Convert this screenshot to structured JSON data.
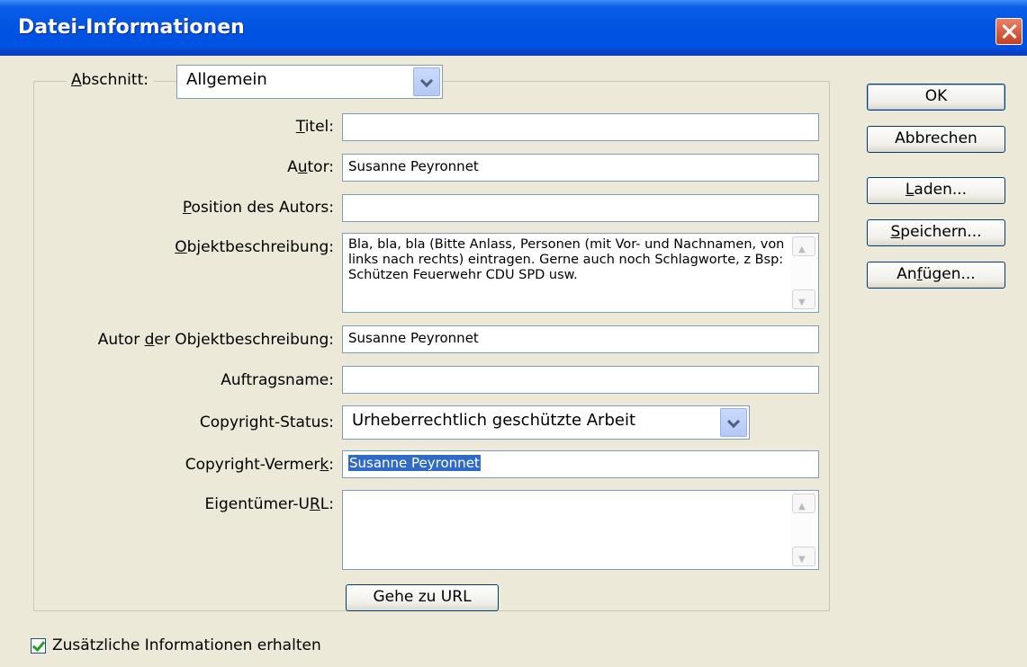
{
  "window": {
    "title": "Datei-Informationen"
  },
  "section": {
    "label_accel": "A",
    "label_rest": "bschnitt:",
    "value": "Allgemein"
  },
  "fields": {
    "titel": {
      "label_accel": "T",
      "label_rest": "itel:",
      "value": ""
    },
    "autor": {
      "label_pre": "A",
      "label_accel": "u",
      "label_rest": "tor:",
      "value": "Susanne Peyronnet"
    },
    "position": {
      "label_accel": "P",
      "label_rest": "osition des Autors:",
      "value": ""
    },
    "beschreibung": {
      "label_pre": "",
      "label_accel": "O",
      "label_rest": "bjektbeschreibung:",
      "value": "Bla, bla, bla (Bitte Anlass, Personen (mit Vor- und Nachnamen, von links nach rechts) eintragen. Gerne auch noch Schlagworte, z Bsp: Schützen Feuerwehr CDU SPD usw."
    },
    "autor_beschreibung": {
      "label_pre": "Autor ",
      "label_accel": "d",
      "label_rest": "er Objektbeschreibung:",
      "value": "Susanne Peyronnet"
    },
    "auftragsname": {
      "label_pre": "Auftra",
      "label_accel": "g",
      "label_rest": "sname:",
      "value": ""
    },
    "copyright_status": {
      "label_pre": "Copyright-Status:",
      "value": "Urheberrechtlich geschützte Arbeit"
    },
    "copyright_vermerk": {
      "label_pre": "Copyright-Vermer",
      "label_accel": "k",
      "label_rest": ":",
      "value": "Susanne Peyronnet"
    },
    "eigentuemer_url": {
      "label_pre": "Eigentümer-U",
      "label_accel": "R",
      "label_rest": "L:",
      "value": ""
    }
  },
  "buttons": {
    "ok": "OK",
    "abbrechen": "Abbrechen",
    "laden": {
      "accel": "L",
      "rest": "aden..."
    },
    "speichern": {
      "accel": "S",
      "rest": "peichern..."
    },
    "anfuegen": {
      "pre": "An",
      "accel": "f",
      "rest": "ügen..."
    },
    "gehe_zu_url": "Gehe zu URL"
  },
  "checkbox": {
    "label": "Zusätzliche Informationen erhalten",
    "checked": true
  }
}
